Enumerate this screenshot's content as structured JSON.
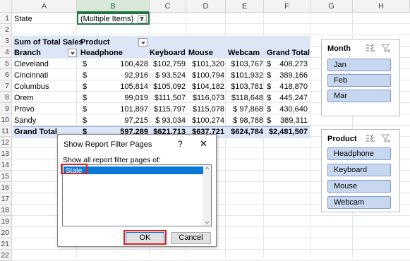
{
  "columns": [
    "A",
    "B",
    "C",
    "D",
    "E",
    "F",
    "G",
    "H"
  ],
  "rows": [
    "1",
    "2",
    "3",
    "4",
    "5",
    "6",
    "7",
    "8",
    "9",
    "10",
    "11",
    "12",
    "13",
    "14",
    "15",
    "16",
    "17",
    "18",
    "19",
    "20",
    "21",
    "22"
  ],
  "filter": {
    "label": "State",
    "value": "(Multiple Items)"
  },
  "pivot": {
    "header1": {
      "values_label": "Sum of Total Sales",
      "columns_label": "Product"
    },
    "header2": {
      "row_label": "Branch",
      "cols": [
        "Headphone",
        "Keyboard",
        "Mouse",
        "Webcam",
        "Grand Total"
      ]
    },
    "rows": [
      {
        "branch": "Cleveland",
        "cur": "$",
        "headphone": "100,428",
        "keyboard": "$102,759",
        "mouse": "$101,320",
        "webcam": "$103,767",
        "total_cur": "$",
        "total": "408,273"
      },
      {
        "branch": "Cincinnati",
        "cur": "$",
        "headphone": "92,916",
        "keyboard": "$ 93,524",
        "mouse": "$100,794",
        "webcam": "$101,932",
        "total_cur": "$",
        "total": "389,166"
      },
      {
        "branch": "Columbus",
        "cur": "$",
        "headphone": "105,814",
        "keyboard": "$105,092",
        "mouse": "$104,182",
        "webcam": "$103,781",
        "total_cur": "$",
        "total": "418,870"
      },
      {
        "branch": "Orem",
        "cur": "$",
        "headphone": "99,019",
        "keyboard": "$111,507",
        "mouse": "$116,073",
        "webcam": "$118,648",
        "total_cur": "$",
        "total": "445,247"
      },
      {
        "branch": "Provo",
        "cur": "$",
        "headphone": "101,897",
        "keyboard": "$115,797",
        "mouse": "$115,078",
        "webcam": "$ 97,868",
        "total_cur": "$",
        "total": "430,640"
      },
      {
        "branch": "Sandy",
        "cur": "$",
        "headphone": "97,215",
        "keyboard": "$ 93,034",
        "mouse": "$100,274",
        "webcam": "$ 98,788",
        "total_cur": "$",
        "total": "389,311"
      }
    ],
    "grand": {
      "label": "Grand Total",
      "cur": "$",
      "headphone": "597,289",
      "keyboard": "$621,713",
      "mouse": "$637,721",
      "webcam": "$624,784",
      "total": "$2,481,507"
    }
  },
  "slicer_month": {
    "title": "Month",
    "items": [
      "Jan",
      "Feb",
      "Mar"
    ]
  },
  "slicer_product": {
    "title": "Product",
    "items": [
      "Headphone",
      "Keyboard",
      "Mouse",
      "Webcam"
    ]
  },
  "dialog": {
    "title": "Show Report Filter Pages",
    "help": "?",
    "close": "✕",
    "label": "Show all report filter pages of:",
    "list_items": [
      "State"
    ],
    "ok": "OK",
    "cancel": "Cancel"
  },
  "colors": {
    "accent_red": "#e0201c",
    "pivot_band": "#dde6f6",
    "slicer_item": "#c8d7f0",
    "selection_blue": "#0a78d7"
  }
}
